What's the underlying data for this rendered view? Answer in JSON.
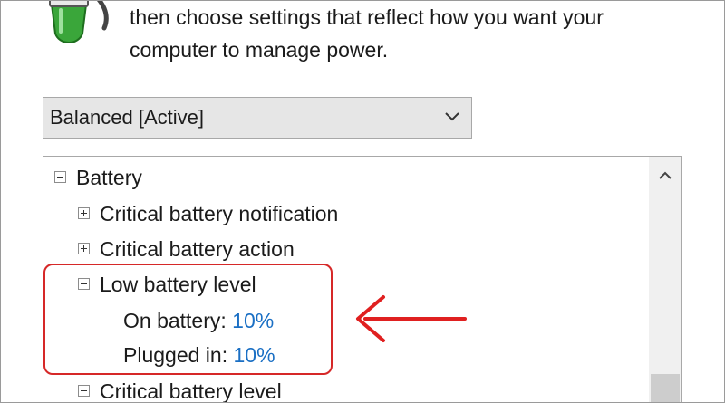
{
  "description": {
    "line1": "then choose settings that reflect how you want your",
    "line2": "computer to manage power."
  },
  "icons": {
    "app": "power-plug-icon",
    "dropdown": "chevron-down-icon",
    "scroll_up": "chevron-up-icon",
    "annotation": "arrow-left-icon"
  },
  "plan_select": {
    "value": "Balanced [Active]"
  },
  "tree": {
    "battery": {
      "label": "Battery",
      "state": "expanded"
    },
    "items": [
      {
        "label": "Critical battery notification",
        "state": "collapsed"
      },
      {
        "label": "Critical battery action",
        "state": "collapsed"
      },
      {
        "label": "Low battery level",
        "state": "expanded",
        "settings": [
          {
            "label": "On battery:",
            "value": "10%"
          },
          {
            "label": "Plugged in:",
            "value": "10%"
          }
        ]
      },
      {
        "label": "Critical battery level",
        "state": "expanded"
      }
    ]
  },
  "colors": {
    "annotation": "#d62828",
    "link": "#1a6fc4",
    "icon_green": "#3aa63a"
  }
}
